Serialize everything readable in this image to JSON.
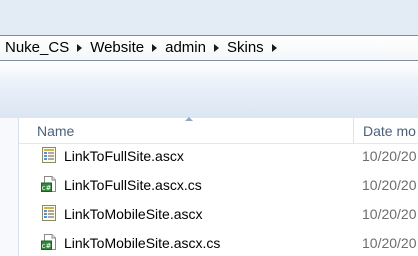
{
  "breadcrumb": {
    "items": [
      "Nuke_CS",
      "Website",
      "admin",
      "Skins"
    ]
  },
  "columns": {
    "name": "Name",
    "date": "Date mo"
  },
  "files": [
    {
      "name": "LinkToFullSite.ascx",
      "date": "10/20/20",
      "icon": "ascx-file-icon"
    },
    {
      "name": "LinkToFullSite.ascx.cs",
      "date": "10/20/20",
      "icon": "csharp-file-icon"
    },
    {
      "name": "LinkToMobileSite.ascx",
      "date": "10/20/20",
      "icon": "ascx-file-icon"
    },
    {
      "name": "LinkToMobileSite.ascx.cs",
      "date": "10/20/20",
      "icon": "csharp-file-icon"
    }
  ],
  "colors": {
    "header_text": "#4c607a",
    "date_text": "#6d6d6d",
    "toolbar_top": "#f5f8fc",
    "toolbar_bottom": "#dbe6f3"
  }
}
